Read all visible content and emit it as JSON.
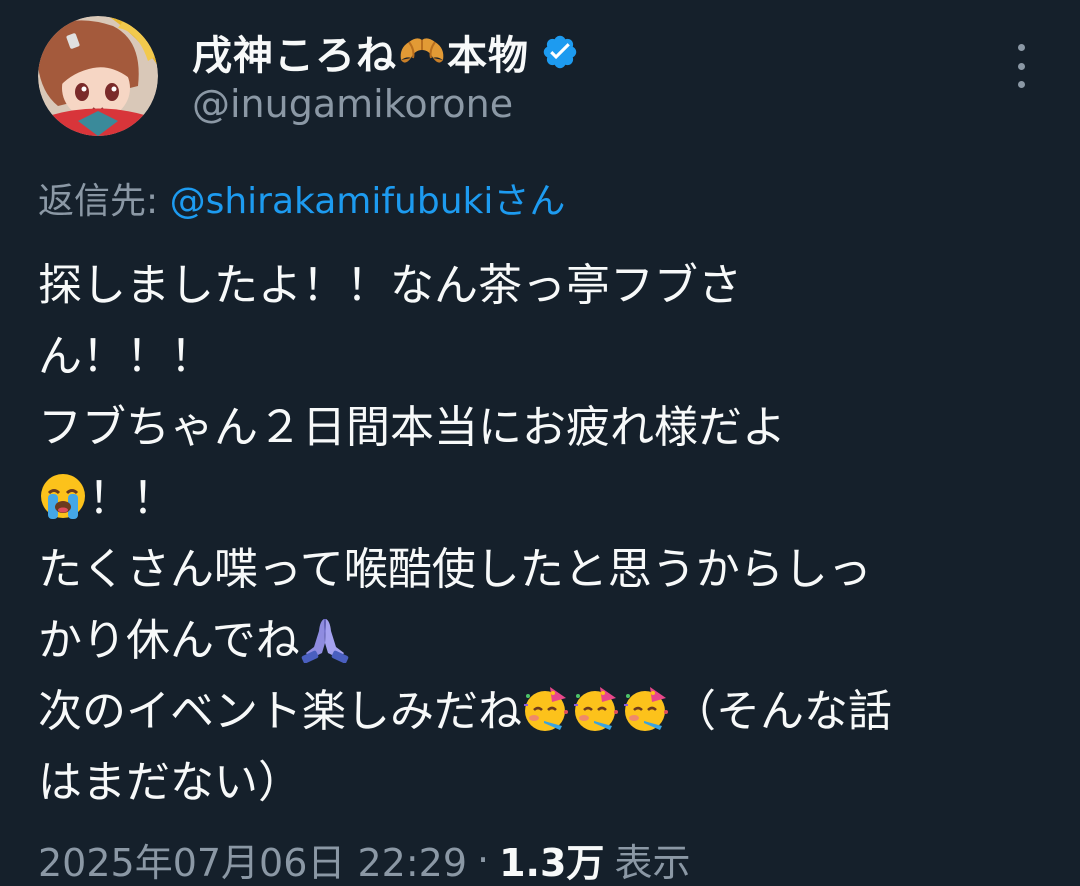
{
  "author": {
    "display_name": "戌神ころね",
    "display_name_suffix": "本物",
    "handle": "@inugamikorone",
    "name_emoji": "croissant-icon",
    "verified": true
  },
  "reply": {
    "prefix": "返信先: ",
    "mention": "@shirakamifubukiさん"
  },
  "tweet": {
    "lines": [
      "探しましたよ！！なん茶っ亭フブさ",
      "ん！！！",
      "フブちゃん２日間本当にお疲れ様だよ",
      "！！",
      "たくさん喋って喉酷使したと思うからしっ",
      "かり休んでね",
      "次のイベント楽しみだね",
      "（そんな話",
      "はまだない）"
    ]
  },
  "meta": {
    "timestamp": "2025年07月06日 22:29",
    "separator": "·",
    "views_count": "1.3万",
    "views_label": "表示"
  },
  "colors": {
    "background": "#15202b",
    "text": "#f7f9f9",
    "secondary": "#8b98a5",
    "accent": "#1d9bf0"
  }
}
